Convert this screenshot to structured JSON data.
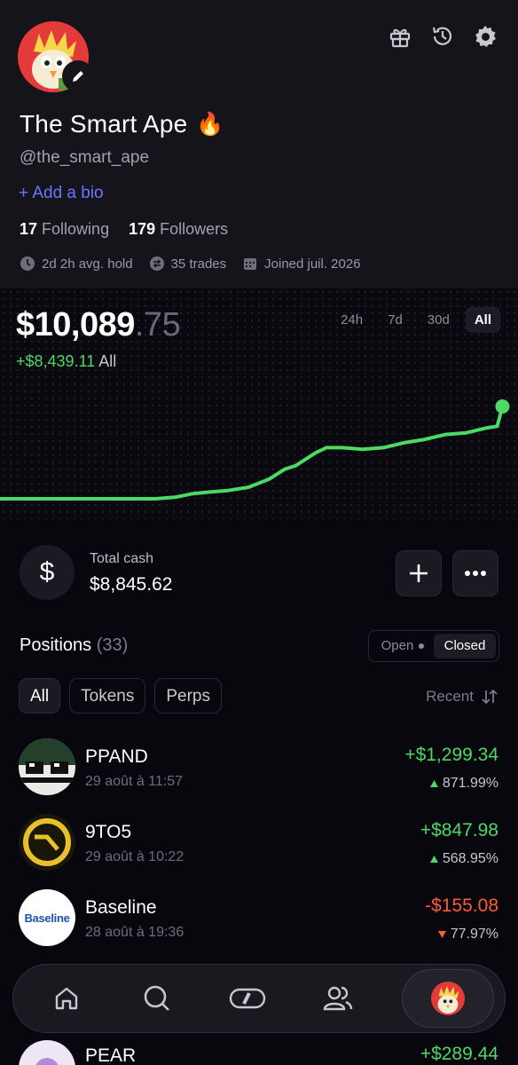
{
  "profile": {
    "name": "The Smart Ape",
    "name_emoji": "🔥",
    "handle": "@the_smart_ape",
    "add_bio": "+ Add a bio",
    "following_count": "17",
    "following_label": "Following",
    "followers_count": "179",
    "followers_label": "Followers",
    "avg_hold": "2d 2h avg. hold",
    "trades": "35 trades",
    "joined": "Joined juil. 2026",
    "top_icons": [
      "gift-icon",
      "history-icon",
      "settings-icon"
    ]
  },
  "balance": {
    "whole": "$10,089",
    "cents": ".75",
    "gain": "+$8,439.11",
    "gain_period": "All",
    "ranges": [
      "24h",
      "7d",
      "30d",
      "All"
    ],
    "active_range": "All"
  },
  "chart_data": {
    "type": "line",
    "x": [
      0,
      10,
      20,
      30,
      34,
      37,
      40,
      44,
      48,
      52,
      55,
      57,
      59,
      61,
      63,
      66,
      70,
      74,
      78,
      82,
      86,
      90,
      94,
      96,
      97
    ],
    "y": [
      0,
      0,
      0,
      0,
      1,
      3,
      4,
      5,
      7,
      12,
      18,
      20,
      24,
      28,
      31,
      31,
      30,
      31,
      34,
      36,
      39,
      40,
      43,
      44,
      56
    ],
    "series": [
      {
        "values": [
          0,
          0,
          0,
          0,
          1,
          3,
          4,
          5,
          7,
          12,
          18,
          20,
          24,
          28,
          31,
          31,
          30,
          31,
          34,
          36,
          39,
          40,
          43,
          44,
          56
        ]
      }
    ],
    "color": "#4cd964",
    "xlabel": "",
    "ylabel": "",
    "grid": false
  },
  "cash": {
    "label": "Total cash",
    "value": "$8,845.62",
    "icon": "$"
  },
  "positions": {
    "title": "Positions",
    "count": "(33)",
    "toggle": [
      "Open",
      "Closed"
    ],
    "active_toggle": "Closed",
    "filters": [
      "All",
      "Tokens",
      "Perps"
    ],
    "active_filter": "All",
    "sort_label": "Recent",
    "items": [
      {
        "name": "PPAND",
        "date": "29 août à 11:57",
        "pnl": "+$1,299.34",
        "pct": "871.99%",
        "direction": "up"
      },
      {
        "name": "9TO5",
        "date": "29 août à 10:22",
        "pnl": "+$847.98",
        "pct": "568.95%",
        "direction": "up"
      },
      {
        "name": "Baseline",
        "date": "28 août à 19:36",
        "pnl": "-$155.08",
        "pct": "77.97%",
        "direction": "down",
        "logo_text": "Baseline"
      },
      {
        "name": "PEAR",
        "pnl": "+$289.44",
        "direction": "up"
      }
    ]
  },
  "nav": {
    "items": [
      "home-icon",
      "search-icon",
      "swap-icon",
      "people-icon",
      "profile-avatar"
    ]
  },
  "colors": {
    "accent_green": "#4cd964",
    "accent_red": "#ff5a36",
    "link_blue": "#6478ff",
    "avatar_red": "#e53a3a"
  }
}
